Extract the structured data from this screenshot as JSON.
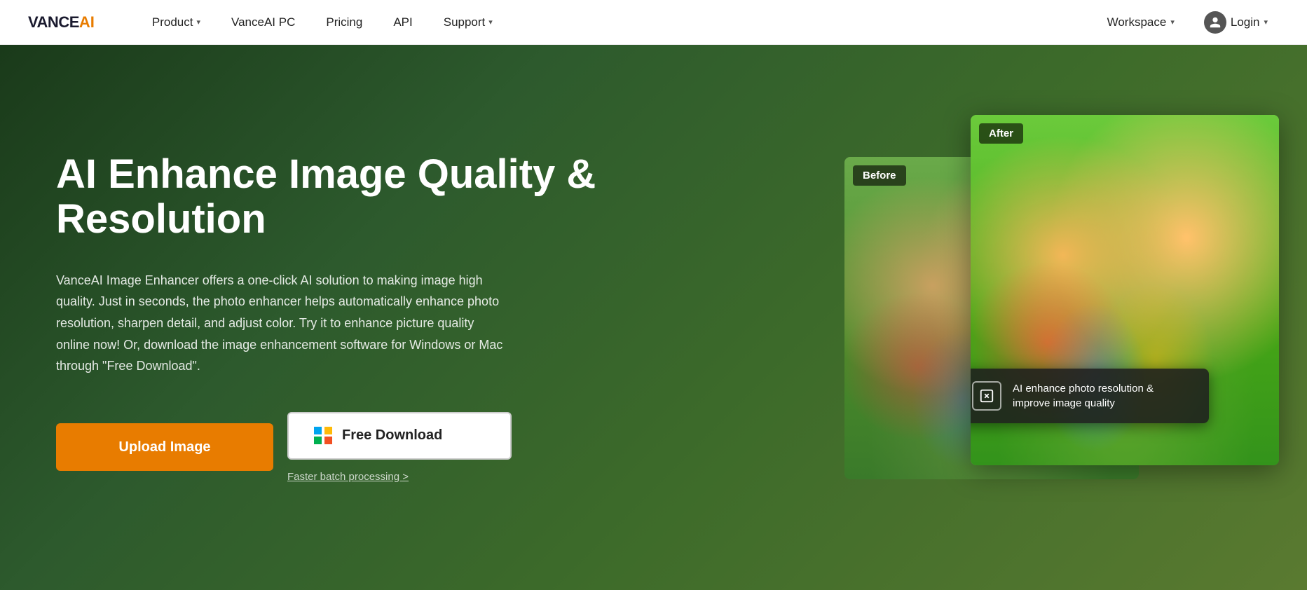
{
  "logo": {
    "vance": "VANCE",
    "ai": "AI"
  },
  "nav": {
    "product": "Product",
    "vanceai_pc": "VanceAI PC",
    "pricing": "Pricing",
    "api": "API",
    "support": "Support",
    "workspace": "Workspace",
    "login": "Login"
  },
  "hero": {
    "title": "AI Enhance Image Quality & Resolution",
    "description": "VanceAI Image Enhancer offers a one-click AI solution to making image high quality. Just in seconds, the photo enhancer helps automatically enhance photo resolution, sharpen detail, and adjust color. Try it to enhance picture quality online now! Or, download the image enhancement software for Windows or Mac through \"Free Download\".",
    "upload_label": "Upload Image",
    "download_label": "Free Download",
    "batch_link": "Faster batch processing >",
    "before_label": "Before",
    "after_label": "After",
    "tooltip_text": "AI enhance photo resolution & improve image quality",
    "tooltip_icon": "⬛"
  },
  "colors": {
    "accent_orange": "#e87c00",
    "nav_bg": "#ffffff",
    "hero_bg_start": "#1a3a1a",
    "hero_bg_end": "#5a7a30"
  }
}
